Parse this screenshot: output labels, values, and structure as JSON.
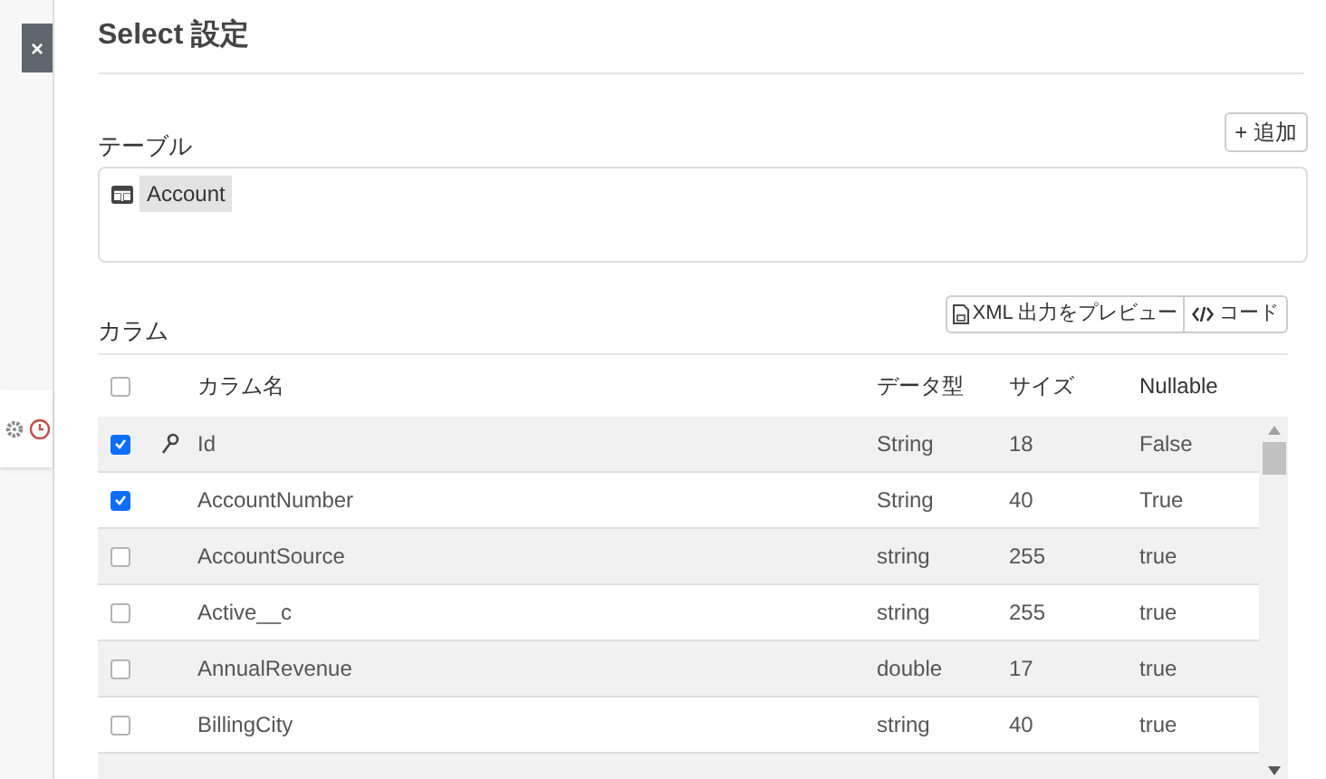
{
  "close_label": "×",
  "title": "Select 設定",
  "table_section": {
    "label": "テーブル",
    "add_button": "+ 追加",
    "tables": [
      "Account"
    ]
  },
  "column_section": {
    "label": "カラム",
    "preview_button": "XML 出力をプレビュー",
    "code_button": "コード"
  },
  "columns": {
    "all_checked": false,
    "headers": [
      "カラム名",
      "データ型",
      "サイズ",
      "Nullable"
    ]
  },
  "rows": [
    {
      "checked": true,
      "primary_key": true,
      "name": "Id",
      "type": "String",
      "size": "18",
      "nullable": "False"
    },
    {
      "checked": true,
      "primary_key": false,
      "name": "AccountNumber",
      "type": "String",
      "size": "40",
      "nullable": "True"
    },
    {
      "checked": false,
      "primary_key": false,
      "name": "AccountSource",
      "type": "string",
      "size": "255",
      "nullable": "true"
    },
    {
      "checked": false,
      "primary_key": false,
      "name": "Active__c",
      "type": "string",
      "size": "255",
      "nullable": "true"
    },
    {
      "checked": false,
      "primary_key": false,
      "name": "AnnualRevenue",
      "type": "double",
      "size": "17",
      "nullable": "true"
    },
    {
      "checked": false,
      "primary_key": false,
      "name": "BillingCity",
      "type": "string",
      "size": "40",
      "nullable": "true"
    }
  ]
}
